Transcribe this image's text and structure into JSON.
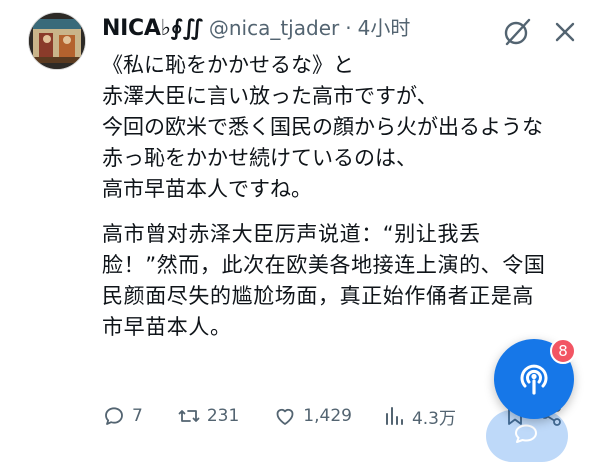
{
  "tweet": {
    "display_name": "NICA♭∮∬",
    "handle": "@nica_tjader",
    "separator": "·",
    "time": "4小时",
    "original_text": "《私に恥をかかせるな》と\n赤澤大臣に言い放った高市ですが、\n今回の欧米で悉く国民の顔から火が出るような\n赤っ恥をかかせ続けているのは、\n高市早苗本人ですね。",
    "translation_text": "高市曾对赤泽大臣厉声说道：“别让我丢\n脸！”然而，此次在欧美各地接连上演的、令国\n民颜面尽失的尴尬场面，真正始作俑者正是高\n市早苗本人。"
  },
  "actions": {
    "replies": "7",
    "retweets": "231",
    "likes": "1,429",
    "views": "4.3万"
  },
  "floating_button": {
    "badge": "8",
    "color": "#1677e8",
    "badge_color": "#f25563"
  },
  "icons": {
    "header": [
      "grok-icon",
      "close-icon"
    ],
    "actions": [
      "reply-icon",
      "retweet-icon",
      "like-icon",
      "views-icon",
      "bookmark-icon",
      "share-icon"
    ],
    "floating": "podcast-icon"
  }
}
